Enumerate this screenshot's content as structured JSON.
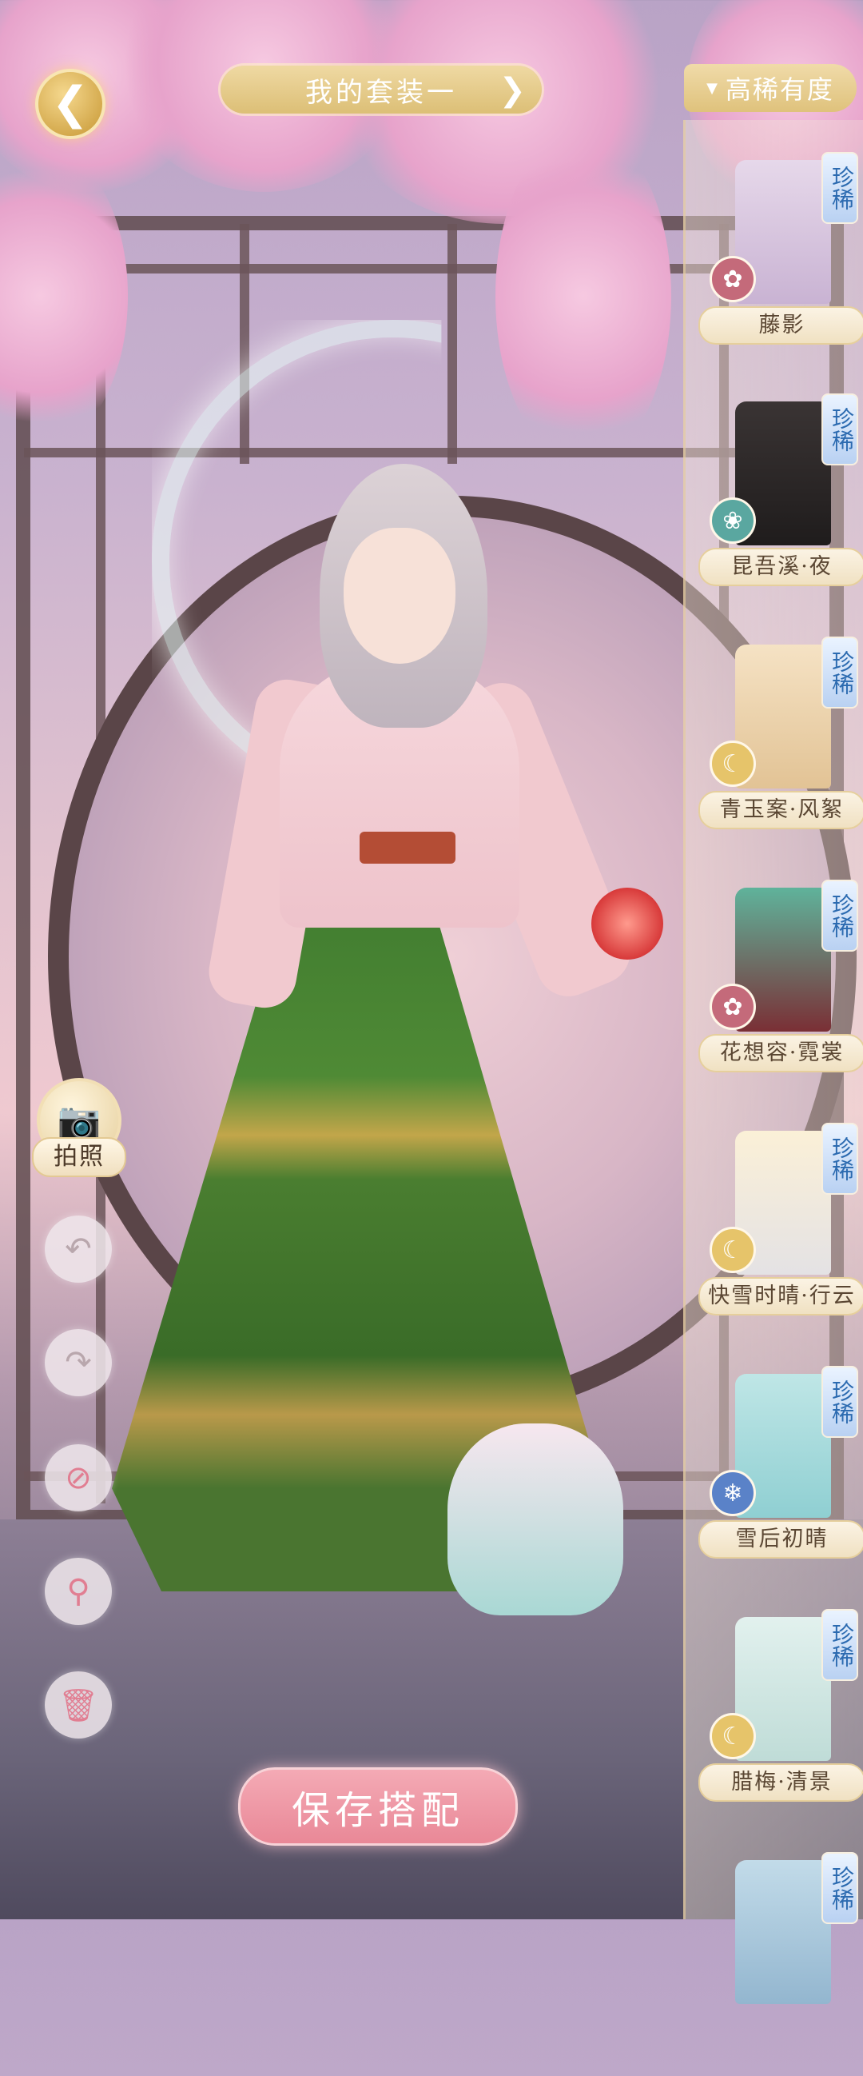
{
  "header": {
    "back_icon": "back-arrow-icon",
    "outfit_name": "我的套装一",
    "outfit_next_icon": "chevron-right-icon",
    "sort_label": "高稀有度",
    "sort_icon": "caret-down-icon"
  },
  "items": [
    {
      "name": "藤影",
      "rarity": "珍稀",
      "theme_icon": "lotus-icon",
      "theme_color": "#c46a7a",
      "garment_color": "#d9c6e0"
    },
    {
      "name": "昆吾溪·夜",
      "rarity": "珍稀",
      "theme_icon": "swirl-icon",
      "theme_color": "#5aa7a0",
      "garment_color": "#2b2727"
    },
    {
      "name": "青玉案·风絮",
      "rarity": "珍稀",
      "theme_icon": "moon-icon",
      "theme_color": "#e6c46a",
      "garment_color": "#efd8b5"
    },
    {
      "name": "花想容·霓裳",
      "rarity": "珍稀",
      "theme_icon": "lotus-icon",
      "theme_color": "#c46a7a",
      "garment_color": "#3e8e78"
    },
    {
      "name": "快雪时晴·行云",
      "rarity": "珍稀",
      "theme_icon": "moon-icon",
      "theme_color": "#e6c46a",
      "garment_color": "#ece9ea"
    },
    {
      "name": "雪后初晴",
      "rarity": "珍稀",
      "theme_icon": "snowflake-icon",
      "theme_color": "#5a82c8",
      "garment_color": "#a9d9dc"
    },
    {
      "name": "腊梅·清景",
      "rarity": "珍稀",
      "theme_icon": "moon-icon",
      "theme_color": "#e6c46a",
      "garment_color": "#cfe8e3"
    },
    {
      "name": "",
      "rarity": "珍稀",
      "theme_icon": "",
      "theme_color": "",
      "garment_color": "#a8c6d9"
    }
  ],
  "tools": {
    "camera_icon": "camera-icon",
    "camera_label": "拍照",
    "undo_icon": "undo-icon",
    "redo_icon": "redo-icon",
    "hide_icon": "prohibit-icon",
    "zoom_icon": "magnifier-icon",
    "delete_icon": "trash-icon"
  },
  "footer": {
    "save_label": "保存搭配"
  },
  "colors": {
    "gold": "#dcbf76",
    "save_pink": "#e98897",
    "rarity_blue": "#2b6ab0"
  }
}
